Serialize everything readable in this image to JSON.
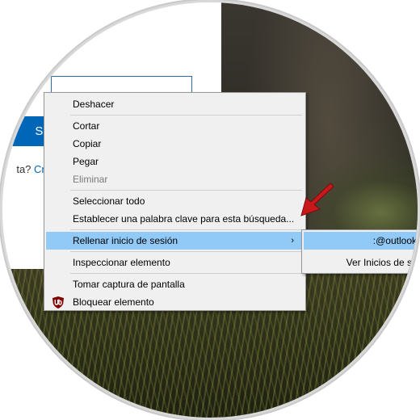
{
  "login": {
    "next_button_label": "Sig",
    "prompt_text": "ta?",
    "create_link_text": "Cre"
  },
  "context_menu": {
    "items": [
      {
        "label": "Deshacer",
        "disabled": false
      },
      {
        "label": "Cortar",
        "disabled": false
      },
      {
        "label": "Copiar",
        "disabled": false
      },
      {
        "label": "Pegar",
        "disabled": false
      },
      {
        "label": "Eliminar",
        "disabled": true
      },
      {
        "label": "Seleccionar todo",
        "disabled": false
      },
      {
        "label": "Establecer una palabra clave para esta búsqueda...",
        "disabled": false
      },
      {
        "label": "Rellenar inicio de sesión",
        "disabled": false,
        "has_submenu": true,
        "highlighted": true
      },
      {
        "label": "Inspeccionar elemento",
        "disabled": false
      },
      {
        "label": "Tomar captura de pantalla",
        "disabled": false
      },
      {
        "label": "Bloquear elemento",
        "disabled": false,
        "icon": "ublock-icon"
      }
    ],
    "submenu_arrow": "›"
  },
  "sub_menu": {
    "items": [
      {
        "label": ":@outlook.co",
        "highlighted": true
      },
      {
        "label": "Ver Inicios de sesió",
        "highlighted": false
      }
    ]
  },
  "colors": {
    "highlight": "#91c9f7",
    "menu_bg": "#f0f0f0",
    "next_button": "#0067b8",
    "annotation_arrow": "#c8181b",
    "ublock_icon": "#800000"
  }
}
